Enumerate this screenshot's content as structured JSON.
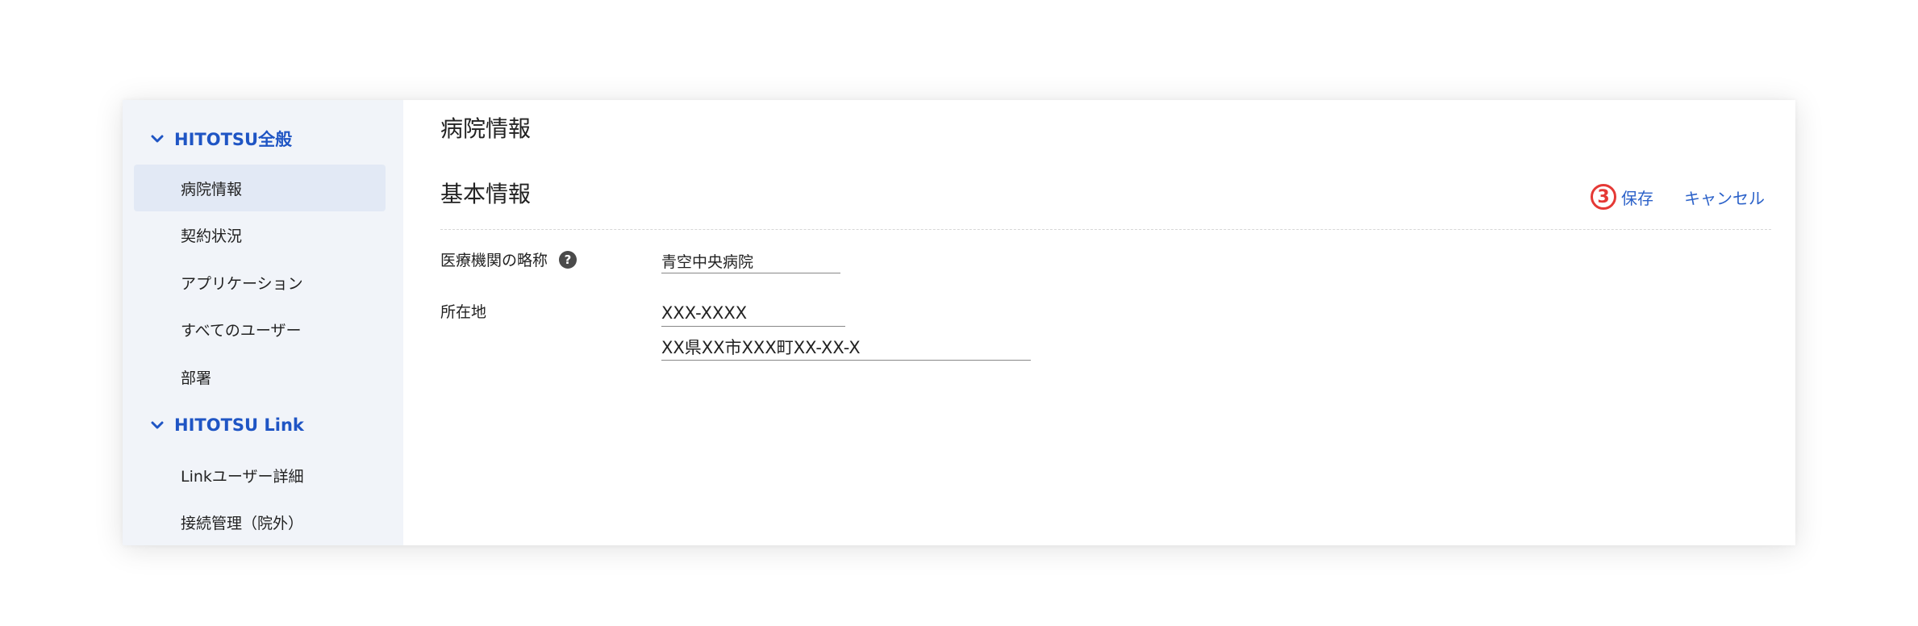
{
  "sidebar": {
    "sections": [
      {
        "label": "HITOTSU全般",
        "items": [
          "病院情報",
          "契約状況",
          "アプリケーション",
          "すべてのユーザー",
          "部署"
        ]
      },
      {
        "label": "HITOTSU Link",
        "items": [
          "Linkユーザー詳細",
          "接続管理（院外）"
        ]
      }
    ],
    "active_item": "病院情報"
  },
  "main": {
    "page_title": "病院情報",
    "section_title": "基本情報",
    "step_badge": "3",
    "save_label": "保存",
    "cancel_label": "キャンセル",
    "fields": {
      "abbreviation": {
        "label": "医療機関の略称",
        "value": "青空中央病院"
      },
      "address": {
        "label": "所在地",
        "postal_code": "XXX-XXXX",
        "street": "XX県XX市XXX町XX-XX-X"
      }
    }
  },
  "colors": {
    "accent": "#1f55c4",
    "sidebar_bg": "#f1f4f9",
    "sidebar_active_bg": "#e2e9f5",
    "step_badge": "#e53935"
  }
}
